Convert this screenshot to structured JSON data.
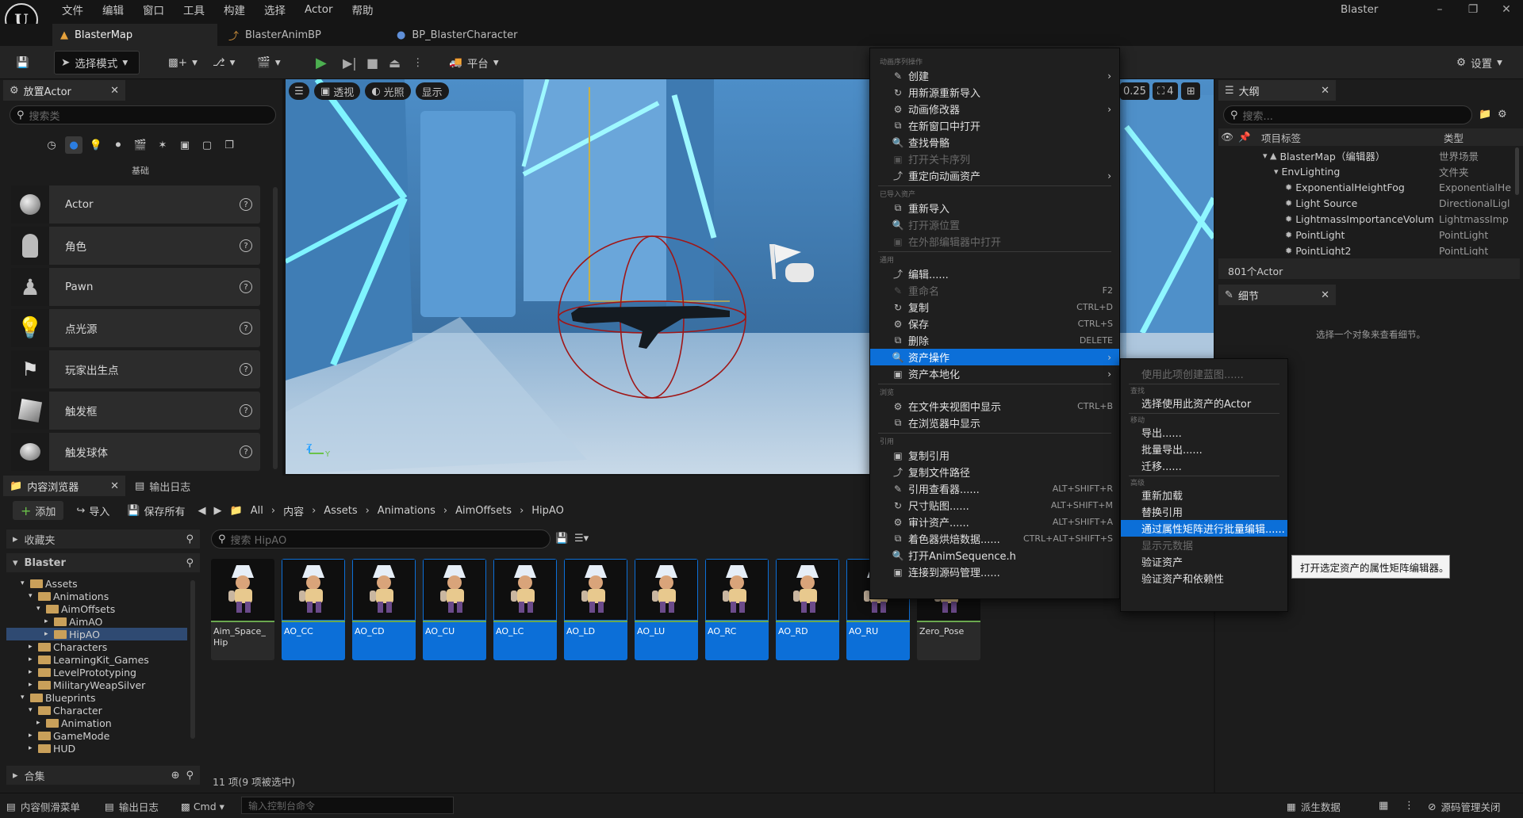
{
  "menubar": [
    "文件",
    "编辑",
    "窗口",
    "工具",
    "构建",
    "选择",
    "Actor",
    "帮助"
  ],
  "app_title": "Blaster",
  "doc_tabs": [
    "BlasterMap",
    "BlasterAnimBP",
    "BP_BlasterCharacter"
  ],
  "toolbar": {
    "select_mode": "选择模式",
    "platform": "平台",
    "settings": "设置"
  },
  "place_actors": {
    "tab": "放置Actor",
    "search_placeholder": "搜索类",
    "category": "基础",
    "items": [
      "Actor",
      "角色",
      "Pawn",
      "点光源",
      "玩家出生点",
      "触发框",
      "触发球体"
    ]
  },
  "viewport": {
    "perspective": "透视",
    "lit": "光照",
    "show": "显示",
    "fov": "0.25",
    "cam_speed": "4"
  },
  "content_browser": {
    "tab": "内容浏览器",
    "log_tab": "输出日志",
    "add": "添加",
    "import": "导入",
    "save_all": "保存所有",
    "breadcrumb": [
      "All",
      "内容",
      "Assets",
      "Animations",
      "AimOffsets",
      "HipAO"
    ],
    "favorites": "收藏夹",
    "root": "Blaster",
    "tree": [
      {
        "name": "Assets",
        "depth": 1,
        "open": true
      },
      {
        "name": "Animations",
        "depth": 2,
        "open": true
      },
      {
        "name": "AimOffsets",
        "depth": 3,
        "open": true
      },
      {
        "name": "AimAO",
        "depth": 4,
        "open": false
      },
      {
        "name": "HipAO",
        "depth": 4,
        "open": false,
        "selected": true
      },
      {
        "name": "Characters",
        "depth": 2,
        "open": false
      },
      {
        "name": "LearningKit_Games",
        "depth": 2,
        "open": false
      },
      {
        "name": "LevelPrototyping",
        "depth": 2,
        "open": false
      },
      {
        "name": "MilitaryWeapSilver",
        "depth": 2,
        "open": false
      },
      {
        "name": "Blueprints",
        "depth": 1,
        "open": true
      },
      {
        "name": "Character",
        "depth": 2,
        "open": true
      },
      {
        "name": "Animation",
        "depth": 3,
        "open": false
      },
      {
        "name": "GameMode",
        "depth": 2,
        "open": false
      },
      {
        "name": "HUD",
        "depth": 2,
        "open": false
      }
    ],
    "collections": "合集",
    "search_placeholder": "搜索 HipAO",
    "assets": [
      {
        "name": "Aim_Space_\nHip",
        "selected": false
      },
      {
        "name": "AO_CC",
        "selected": true
      },
      {
        "name": "AO_CD",
        "selected": true
      },
      {
        "name": "AO_CU",
        "selected": true
      },
      {
        "name": "AO_LC",
        "selected": true
      },
      {
        "name": "AO_LD",
        "selected": true
      },
      {
        "name": "AO_LU",
        "selected": true
      },
      {
        "name": "AO_RC",
        "selected": true
      },
      {
        "name": "AO_RD",
        "selected": true
      },
      {
        "name": "AO_RU",
        "selected": true
      },
      {
        "name": "Zero_Pose",
        "selected": false
      }
    ],
    "item_count": "11 项(9 项被选中)"
  },
  "outliner": {
    "tab": "大纲",
    "search_placeholder": "搜索...",
    "col_label": "项目标签",
    "col_type": "类型",
    "rows": [
      {
        "label": "BlasterMap（编辑器）",
        "type": "世界场景",
        "depth": 0
      },
      {
        "label": "EnvLighting",
        "type": "文件夹",
        "depth": 1
      },
      {
        "label": "ExponentialHeightFog",
        "type": "ExponentialHe",
        "depth": 2
      },
      {
        "label": "Light Source",
        "type": "DirectionalLigl",
        "depth": 2
      },
      {
        "label": "LightmassImportanceVolum",
        "type": "LightmassImp",
        "depth": 2
      },
      {
        "label": "PointLight",
        "type": "PointLight",
        "depth": 2
      },
      {
        "label": "PointLight2",
        "type": "PointLight",
        "depth": 2
      }
    ],
    "actor_count": "801个Actor"
  },
  "details": {
    "tab": "细节",
    "empty": "选择一个对象来查看细节。"
  },
  "statusbar": {
    "drawer": "内容侧滑菜单",
    "log": "输出日志",
    "cmd": "Cmd",
    "console_placeholder": "输入控制台命令",
    "derived": "派生数据",
    "source": "源码管理关闭"
  },
  "context_menu": {
    "sections": [
      {
        "title": "动画序列操作",
        "items": [
          {
            "label": "创建",
            "arrow": true
          },
          {
            "label": "用新源重新导入"
          },
          {
            "label": "动画修改器",
            "arrow": true
          },
          {
            "label": "在新窗口中打开"
          },
          {
            "label": "查找骨骼"
          },
          {
            "label": "打开关卡序列",
            "disabled": true
          },
          {
            "label": "重定向动画资产",
            "arrow": true
          }
        ]
      },
      {
        "title": "已导入资产",
        "items": [
          {
            "label": "重新导入"
          },
          {
            "label": "打开源位置",
            "disabled": true
          },
          {
            "label": "在外部编辑器中打开",
            "disabled": true
          }
        ]
      },
      {
        "title": "通用",
        "items": [
          {
            "label": "编辑......"
          },
          {
            "label": "重命名",
            "shortcut": "F2",
            "disabled": true
          },
          {
            "label": "复制",
            "shortcut": "CTRL+D"
          },
          {
            "label": "保存",
            "shortcut": "CTRL+S"
          },
          {
            "label": "删除",
            "shortcut": "DELETE"
          },
          {
            "label": "资产操作",
            "arrow": true,
            "highlight": true
          },
          {
            "label": "资产本地化",
            "arrow": true
          }
        ]
      },
      {
        "title": "浏览",
        "items": [
          {
            "label": "在文件夹视图中显示",
            "shortcut": "CTRL+B"
          },
          {
            "label": "在浏览器中显示"
          }
        ]
      },
      {
        "title": "引用",
        "items": [
          {
            "label": "复制引用"
          },
          {
            "label": "复制文件路径"
          },
          {
            "label": "引用查看器......",
            "shortcut": "ALT+SHIFT+R"
          },
          {
            "label": "尺寸贴图......",
            "shortcut": "ALT+SHIFT+M"
          },
          {
            "label": "审计资产......",
            "shortcut": "ALT+SHIFT+A"
          },
          {
            "label": "着色器烘焙数据......",
            "shortcut": "CTRL+ALT+SHIFT+S"
          },
          {
            "label": "打开AnimSequence.h"
          },
          {
            "label": "连接到源码管理......"
          }
        ]
      }
    ]
  },
  "submenu": {
    "items": [
      {
        "label": "使用此项创建蓝图......",
        "disabled": true
      },
      {
        "section": "查找"
      },
      {
        "label": "选择使用此资产的Actor"
      },
      {
        "section": "移动"
      },
      {
        "label": "导出......"
      },
      {
        "label": "批量导出......"
      },
      {
        "label": "迁移......"
      },
      {
        "section": "高级"
      },
      {
        "label": "重新加载"
      },
      {
        "label": "替换引用"
      },
      {
        "label": "通过属性矩阵进行批量编辑......",
        "highlight": true
      },
      {
        "label": "显示元数据",
        "disabled": true
      },
      {
        "label": "验证资产"
      },
      {
        "label": "验证资产和依赖性"
      }
    ]
  },
  "tooltip": "打开选定资产的属性矩阵编辑器。"
}
